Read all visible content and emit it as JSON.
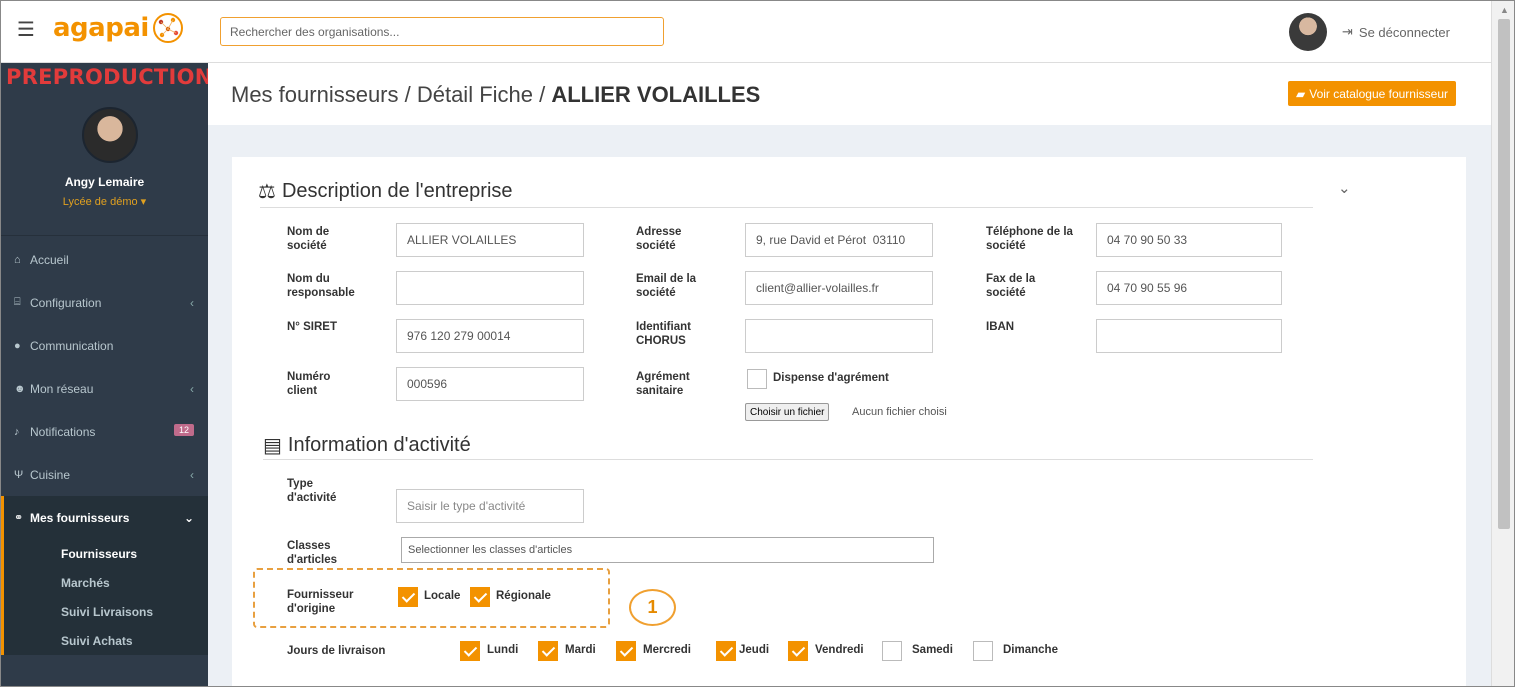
{
  "app": {
    "logo_text": "agapai",
    "environment_label": "PREPRODUCTION",
    "accent_color": "#f39200",
    "sidebar_color": "#2f3b49"
  },
  "topbar": {
    "search_placeholder": "Rechercher des organisations...",
    "logout_label": "Se déconnecter",
    "logout_icon": "sign-out-icon"
  },
  "user": {
    "name": "Angy Lemaire",
    "school": "Lycée de démo ▾"
  },
  "sidebar": {
    "items": [
      {
        "label": "Accueil",
        "icon": "home-icon"
      },
      {
        "label": "Configuration",
        "icon": "bank-icon",
        "chevron": "‹"
      },
      {
        "label": "Communication",
        "icon": "comments-icon"
      },
      {
        "label": "Mon réseau",
        "icon": "users-icon",
        "chevron": "‹"
      },
      {
        "label": "Notifications",
        "icon": "bell-icon",
        "badge": "12"
      },
      {
        "label": "Cuisine",
        "icon": "cutlery-icon",
        "chevron": "‹"
      },
      {
        "label": "Mes fournisseurs",
        "icon": "handshake-icon",
        "chevron": "⌄"
      }
    ],
    "subitems": [
      {
        "label": "Fournisseurs"
      },
      {
        "label": "Marchés"
      },
      {
        "label": "Suivi Livraisons"
      },
      {
        "label": "Suivi Achats"
      }
    ]
  },
  "page": {
    "breadcrumb_prefix": "Mes fournisseurs / Détail Fiche / ",
    "breadcrumb_current": "ALLIER VOLAILLES",
    "catalog_button": "Voir catalogue fournisseur"
  },
  "description": {
    "title": "Description de l'entreprise",
    "fields": {
      "nom_societe": {
        "label": "Nom de société",
        "value": "ALLIER VOLAILLES"
      },
      "nom_responsable": {
        "label": "Nom du responsable",
        "value": ""
      },
      "siret": {
        "label": "N° SIRET",
        "value": "976 120 279 00014"
      },
      "numero_client": {
        "label": "Numéro client",
        "value": "000596"
      },
      "adresse": {
        "label": "Adresse société",
        "value": "9, rue David et Pérot  03110"
      },
      "email": {
        "label": "Email de la société",
        "value": "client@allier-volailles.fr"
      },
      "chorus": {
        "label": "Identifiant CHORUS",
        "value": ""
      },
      "agrement": {
        "label": "Agrément sanitaire"
      },
      "telephone": {
        "label": "Téléphone de la société",
        "value": "04 70 90 50 33"
      },
      "fax": {
        "label": "Fax de la société",
        "value": "04 70 90 55 96"
      },
      "iban": {
        "label": "IBAN",
        "value": ""
      }
    },
    "dispense_label": "Dispense d'agrément",
    "file_button": "Choisir un fichier",
    "file_status": "Aucun fichier choisi"
  },
  "activity": {
    "title": "Information d'activité",
    "type_label": "Type d'activité",
    "type_placeholder": "Saisir le type d'activité",
    "classes_label": "Classes d'articles",
    "classes_placeholder": "Selectionner les classes d'articles",
    "origin_label": "Fournisseur d'origine",
    "origin_options": [
      {
        "label": "Locale",
        "checked": true
      },
      {
        "label": "Régionale",
        "checked": true
      }
    ],
    "delivery_label": "Jours de livraison",
    "delivery_days": [
      {
        "label": "Lundi",
        "checked": true
      },
      {
        "label": "Mardi",
        "checked": true
      },
      {
        "label": "Mercredi",
        "checked": true
      },
      {
        "label": "Jeudi",
        "checked": true
      },
      {
        "label": "Vendredi",
        "checked": true
      },
      {
        "label": "Samedi",
        "checked": false
      },
      {
        "label": "Dimanche",
        "checked": false
      }
    ]
  },
  "annotation": {
    "callout_number": "1"
  }
}
